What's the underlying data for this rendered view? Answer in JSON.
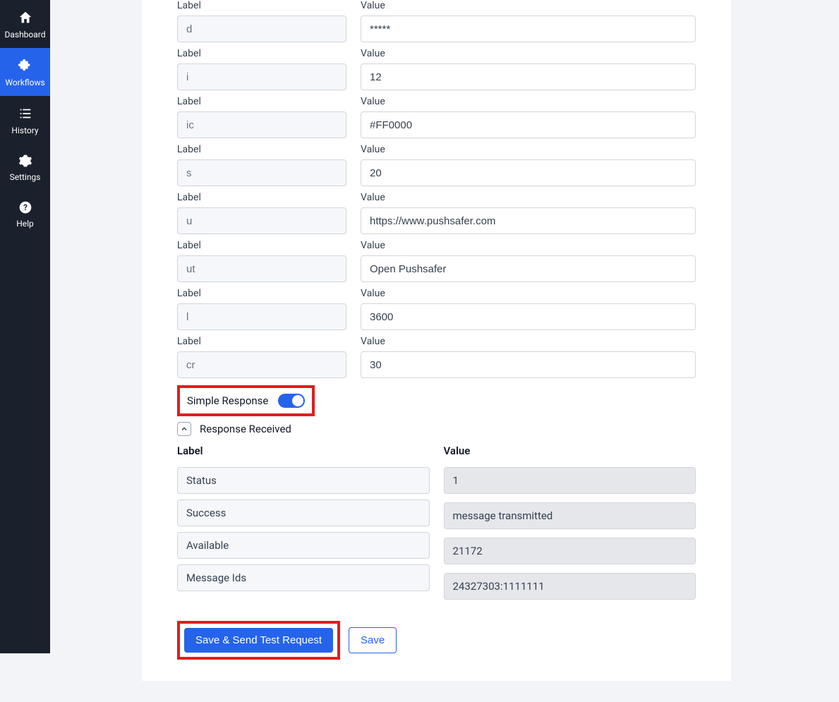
{
  "sidebar": {
    "items": [
      {
        "label": "Dashboard"
      },
      {
        "label": "Workflows"
      },
      {
        "label": "History"
      },
      {
        "label": "Settings"
      },
      {
        "label": "Help"
      }
    ]
  },
  "form": {
    "label_heading": "Label",
    "value_heading": "Value",
    "pairs": [
      {
        "label": "d",
        "value": "*****"
      },
      {
        "label": "i",
        "value": "12"
      },
      {
        "label": "ic",
        "value": "#FF0000"
      },
      {
        "label": "s",
        "value": "20"
      },
      {
        "label": "u",
        "value": "https://www.pushsafer.com"
      },
      {
        "label": "ut",
        "value": "Open Pushsafer"
      },
      {
        "label": "l",
        "value": "3600"
      },
      {
        "label": "cr",
        "value": "30"
      }
    ],
    "simple_response_label": "Simple Response",
    "simple_response_on": true
  },
  "response": {
    "section_title": "Response Received",
    "label_heading": "Label",
    "value_heading": "Value",
    "rows": [
      {
        "label": "Status",
        "value": "1"
      },
      {
        "label": "Success",
        "value": "message transmitted"
      },
      {
        "label": "Available",
        "value": "21172"
      },
      {
        "label": "Message Ids",
        "value": "24327303:1111111"
      }
    ]
  },
  "buttons": {
    "primary": "Save & Send Test Request",
    "secondary": "Save"
  }
}
